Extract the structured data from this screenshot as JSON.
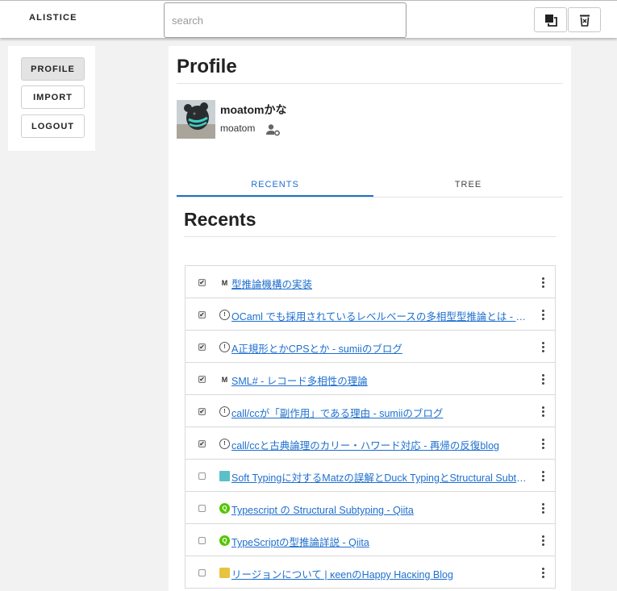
{
  "header": {
    "brand": "ALISTICE",
    "search_placeholder": "search",
    "search_value": "",
    "buttons": [
      {
        "icon": "window-stack-icon"
      },
      {
        "icon": "trash-can-icon"
      }
    ]
  },
  "menu": {
    "items": [
      {
        "label": "PROFILE",
        "active": true
      },
      {
        "label": "IMPORT",
        "active": false
      },
      {
        "label": "LOGOUT",
        "active": false
      }
    ]
  },
  "profile": {
    "title": "Profile",
    "display_name": "moatomかな",
    "username": "moatom",
    "settings_icon": "user-settings-icon"
  },
  "tabs": [
    {
      "label": "RECENTS",
      "active": true
    },
    {
      "label": "TREE",
      "active": false
    }
  ],
  "recents": {
    "title": "Recents",
    "items": [
      {
        "checked": true,
        "favicon": "M",
        "text": "型推論機構の実装"
      },
      {
        "checked": true,
        "favicon": "hatena",
        "text": "OCaml でも採用されているレベルベースの多相型型推論とは - 言語のしくみ"
      },
      {
        "checked": true,
        "favicon": "hatena",
        "text": "A正規形とかCPSとか - sumiiのブログ"
      },
      {
        "checked": true,
        "favicon": "M",
        "text": "SML# - レコード多相性の理論"
      },
      {
        "checked": true,
        "favicon": "hatena",
        "text": "call/ccが「副作用」である理由 - sumiiのブログ"
      },
      {
        "checked": true,
        "favicon": "hatena",
        "text": "call/ccと古典論理のカリー・ハワード対応 - 再帰の反復blog"
      },
      {
        "checked": false,
        "favicon": "teal",
        "text": "Soft Typingに対するMatzの誤解とDuck TypingとStructural Subtyping"
      },
      {
        "checked": false,
        "favicon": "qiita",
        "text": "Typescript の Structural Subtyping - Qiita"
      },
      {
        "checked": false,
        "favicon": "qiita",
        "text": "TypeScriptの型推論詳説 - Qiita"
      },
      {
        "checked": false,
        "favicon": "keen",
        "text": "リージョンについて | κeenのHappy Hacκing Blog"
      }
    ]
  },
  "colors": {
    "accent": "#1e6fcf",
    "background": "#f2f2f2",
    "panel": "#ffffff",
    "active_menu": "#e3e3e3"
  }
}
